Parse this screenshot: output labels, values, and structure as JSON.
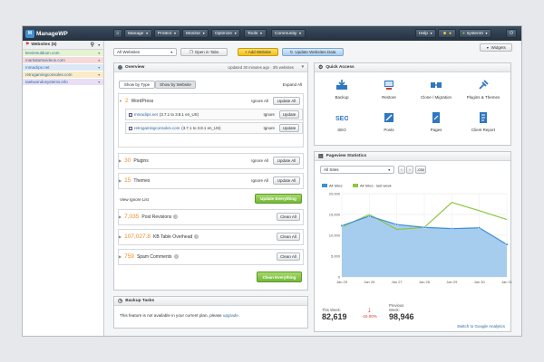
{
  "app": {
    "name": "ManageWP",
    "logo_letter": "M"
  },
  "nav": {
    "items": [
      {
        "label": "Manage"
      },
      {
        "label": "Protect"
      },
      {
        "label": "Monitor"
      },
      {
        "label": "Optimize"
      },
      {
        "label": "Tools"
      },
      {
        "label": "Community"
      }
    ],
    "help_label": "Help",
    "user_label": "system0"
  },
  "sidebar": {
    "title": "Websites (5)",
    "sites": [
      {
        "name": "kevinmuldoon.com",
        "color": "#e5f3d2"
      },
      {
        "name": "martialartsvideos.com",
        "color": "#f7d9d9"
      },
      {
        "name": "mmaclips.net",
        "color": "#dbe8f6"
      },
      {
        "name": "retrogamingconsoles.com",
        "color": "#f9ecc7"
      },
      {
        "name": "taekwondosystems.info",
        "color": "#e8def5"
      }
    ]
  },
  "toolbar": {
    "filter_value": "All Websites",
    "open_tabs_label": "Open in Tabs",
    "add_website_label": "+ Add Website",
    "update_data_label": "Update Websites Data",
    "widgets_label": "Widgets"
  },
  "overview": {
    "title": "Overview",
    "updated_text": "Updated 30 minutes ago · 3/5 websites",
    "tab_type": "Show by Type",
    "tab_website": "Show by Website",
    "expand_all": "Expand All",
    "wordpress": {
      "count": "2",
      "label": "WordPress",
      "ignore_all": "Ignore All",
      "update_all": "Update All"
    },
    "wp_sites": [
      {
        "name": "mmaclips.net",
        "version": "(3.7.1 to 3.8.1 en_US)",
        "ignore": "Ignore",
        "update": "Update"
      },
      {
        "name": "retrogamingconsoles.com",
        "version": "(3.7.1 to 3.8.1 en_US)",
        "ignore": "Ignore",
        "update": "Update"
      }
    ],
    "plugins": {
      "count": "30",
      "label": "Plugins",
      "ignore_all": "Ignore All",
      "update_all": "Update All"
    },
    "themes": {
      "count": "15",
      "label": "Themes",
      "ignore_all": "Ignore All",
      "update_all": "Update All"
    },
    "view_ignore_list": "View Ignore List",
    "update_everything": "Update Everything",
    "post_revisions": {
      "count": "7,035",
      "label": "Post Revisions",
      "clean_all": "Clean All"
    },
    "table_overhead": {
      "count": "107,027.8",
      "label": "KB Table Overhead",
      "clean_all": "Clean All"
    },
    "spam_comments": {
      "count": "759",
      "label": "Spam Comments",
      "clean_all": "Clean All"
    },
    "clean_everything": "Clean Everything"
  },
  "backup": {
    "title": "Backup Tasks",
    "message": "This feature is not available in your current plan, please",
    "upgrade_link": "upgrade"
  },
  "quick_access": {
    "title": "Quick Access",
    "items": [
      {
        "label": "Backup",
        "icon": "backup-icon"
      },
      {
        "label": "Restore",
        "icon": "restore-icon"
      },
      {
        "label": "Clone / Migration",
        "icon": "clone-icon"
      },
      {
        "label": "Plugins & Themes",
        "icon": "plugins-icon"
      },
      {
        "label": "SEO",
        "icon": "seo-icon"
      },
      {
        "label": "Posts",
        "icon": "posts-icon"
      },
      {
        "label": "Pages",
        "icon": "pages-icon"
      },
      {
        "label": "Client Report",
        "icon": "report-icon"
      }
    ]
  },
  "pageview": {
    "title": "Pageview Statistics",
    "select_value": "All Sites",
    "csv_label": ".csv",
    "this_week_label": "This Week:",
    "this_week_value": "82,619",
    "change_value": "-16.00%",
    "prev_week_label": "Previous Week:",
    "prev_week_value": "98,946",
    "switch_link": "Switch to Google Analytics"
  },
  "chart_data": {
    "type": "area",
    "x": [
      "Jan 25",
      "Jan 26",
      "Jan 27",
      "Jan 28",
      "Jan 29",
      "Jan 30",
      "Jan 31"
    ],
    "series": [
      {
        "name": "All Sites",
        "color": "#3d8fd6",
        "values": [
          12300,
          14600,
          12600,
          11900,
          11600,
          11800,
          7800
        ]
      },
      {
        "name": "All Sites - last week",
        "color": "#8dc63f",
        "values": [
          12000,
          15000,
          11400,
          11900,
          17900,
          15900,
          13800
        ]
      }
    ],
    "ylim": [
      0,
      20000
    ],
    "yticks": [
      "0",
      "5,000",
      "10,000",
      "15,000",
      "20,000"
    ],
    "grid": true,
    "legend": "top-left"
  }
}
